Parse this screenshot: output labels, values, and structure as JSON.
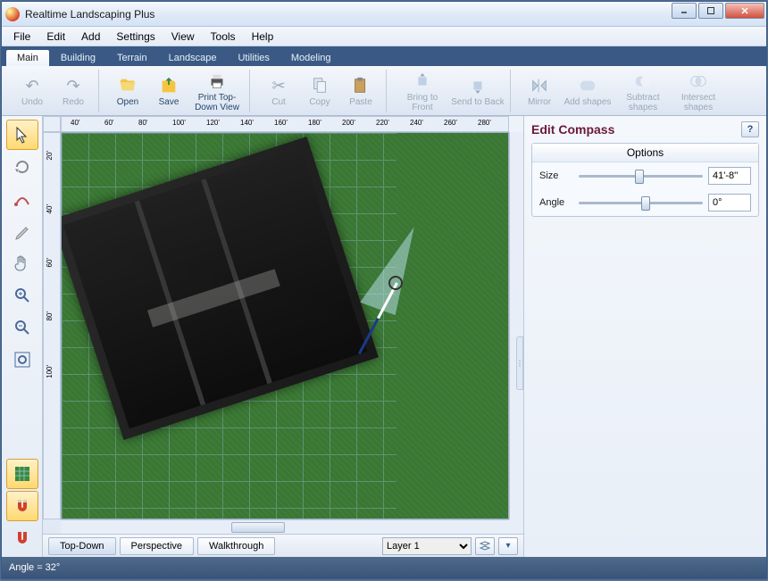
{
  "title": "Realtime Landscaping Plus",
  "menus": [
    "File",
    "Edit",
    "Add",
    "Settings",
    "View",
    "Tools",
    "Help"
  ],
  "tabs": [
    "Main",
    "Building",
    "Terrain",
    "Landscape",
    "Utilities",
    "Modeling"
  ],
  "active_tab": "Main",
  "toolbar": {
    "undo": "Undo",
    "redo": "Redo",
    "open": "Open",
    "save": "Save",
    "print": "Print Top-Down View",
    "cut": "Cut",
    "copy": "Copy",
    "paste": "Paste",
    "bring_front": "Bring to Front",
    "send_back": "Send to Back",
    "mirror": "Mirror",
    "add_shapes": "Add shapes",
    "subtract_shapes": "Subtract shapes",
    "intersect_shapes": "Intersect shapes"
  },
  "ruler_h": [
    "40'",
    "60'",
    "80'",
    "100'",
    "120'",
    "140'",
    "160'",
    "180'",
    "200'",
    "220'",
    "240'",
    "260'",
    "280'"
  ],
  "ruler_v": [
    "20'",
    "40'",
    "60'",
    "80'",
    "100'"
  ],
  "view_tabs": [
    "Top-Down",
    "Perspective",
    "Walkthrough"
  ],
  "active_view_tab": "Top-Down",
  "layer": "Layer 1",
  "panel": {
    "title": "Edit Compass",
    "options_label": "Options",
    "size_label": "Size",
    "size_value": "41'-8''",
    "size_pos": 45,
    "angle_label": "Angle",
    "angle_value": "0°",
    "angle_pos": 50
  },
  "status": "Angle = 32°"
}
